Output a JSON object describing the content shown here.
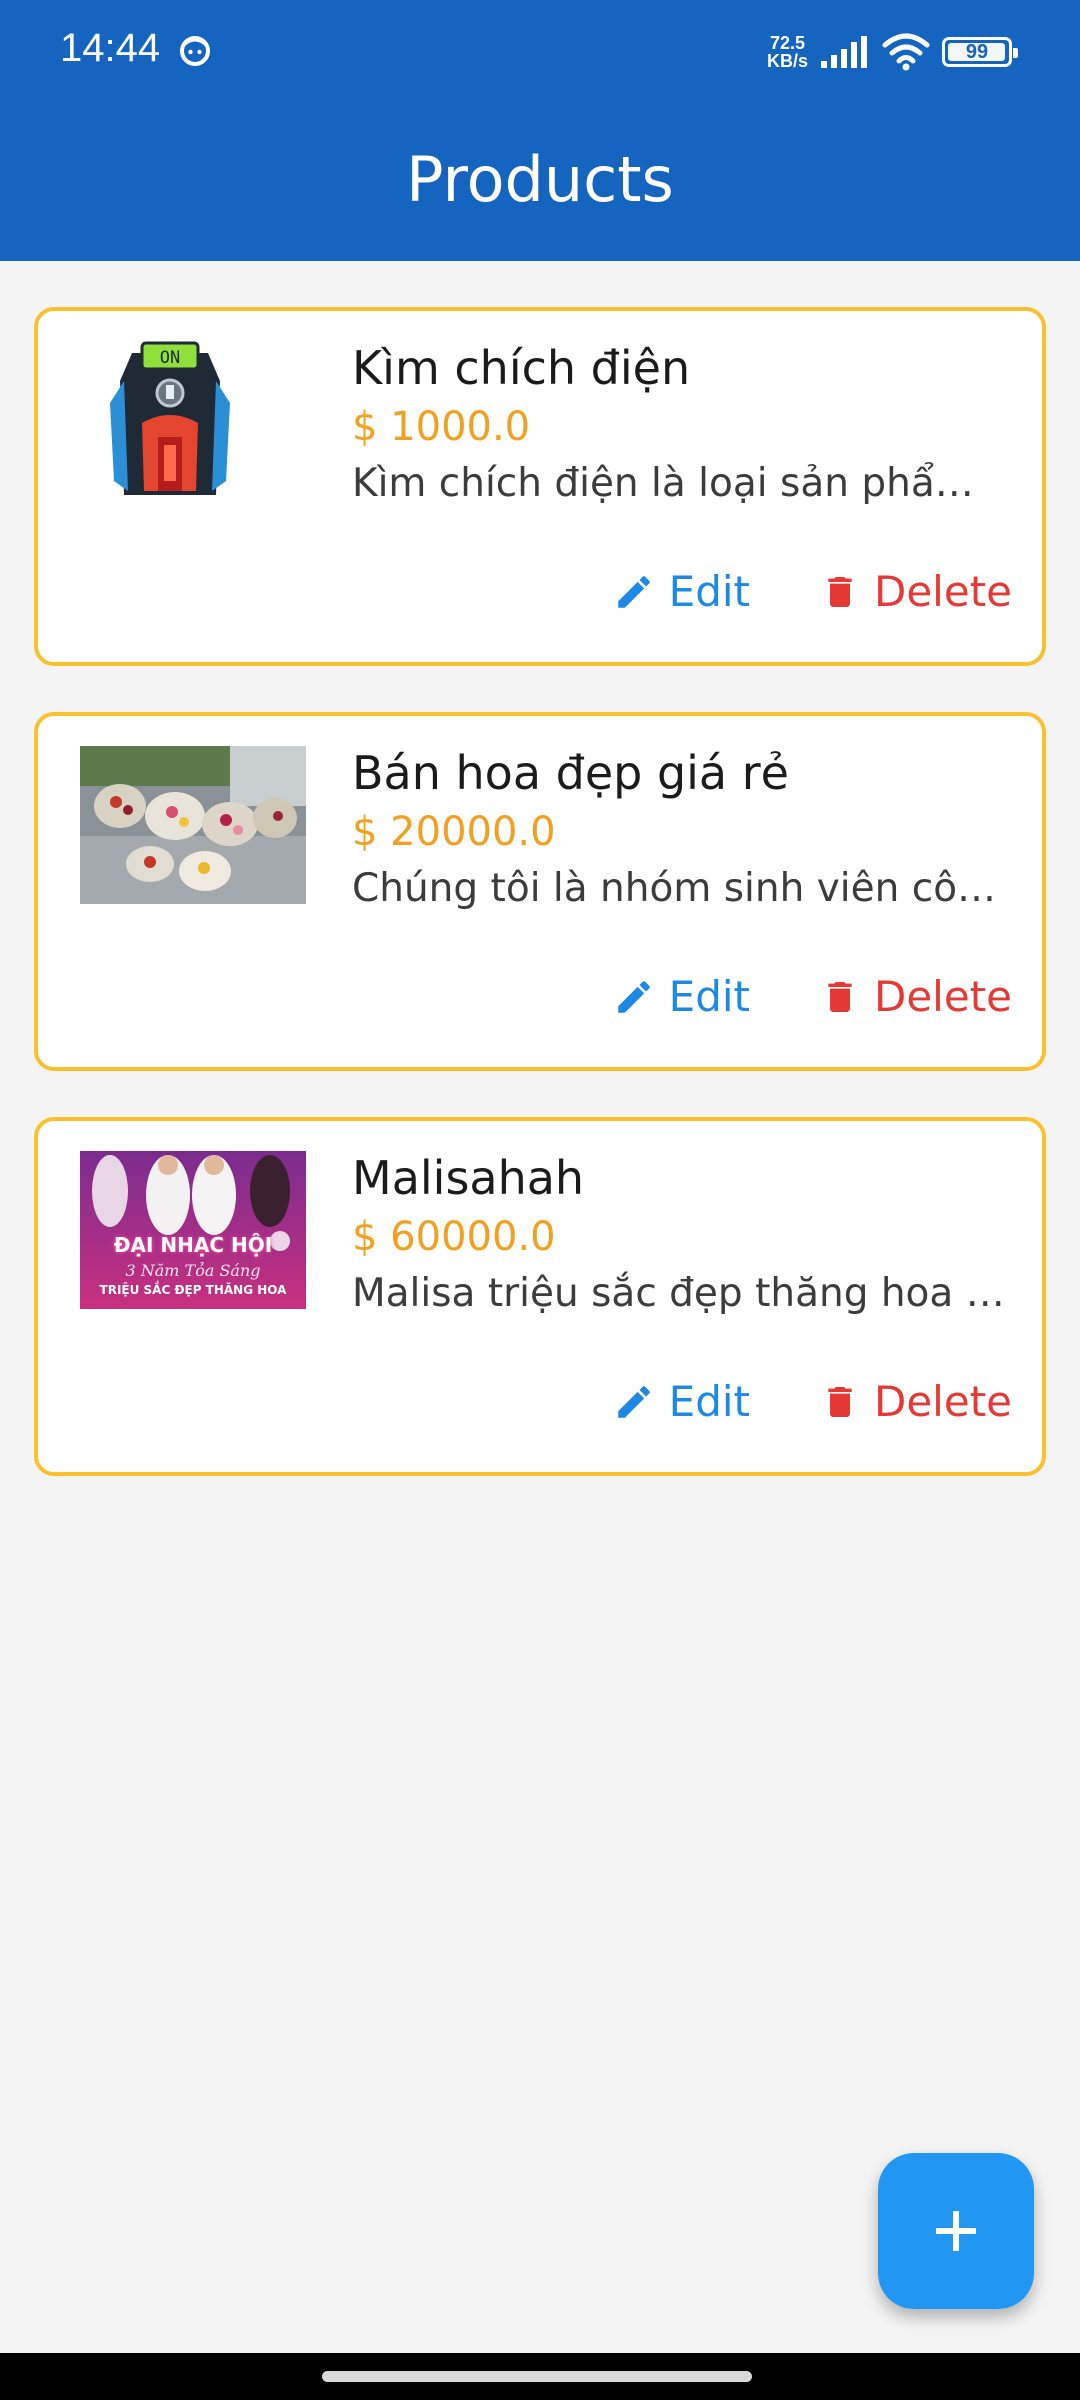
{
  "status_bar": {
    "time": "14:44",
    "net_speed_value": "72.5",
    "net_speed_unit": "KB/s",
    "battery": "99",
    "battery_level": 0.99
  },
  "app_bar": {
    "title": "Products"
  },
  "products": [
    {
      "name": "Kìm chích điện",
      "price": "$ 1000.0",
      "description": "Kìm chích điện là loại sản phẩ…",
      "image": "stun-device-photo",
      "edit_label": "Edit",
      "delete_label": "Delete"
    },
    {
      "name": "Bán hoa đẹp giá rẻ",
      "price": "$ 20000.0",
      "description": "Chúng tôi là nhóm sinh viên cô…",
      "image": "flower-bouquets-photo",
      "edit_label": "Edit",
      "delete_label": "Delete"
    },
    {
      "name": "Malisahah",
      "price": "$ 60000.0",
      "description": "Malisa triệu sắc đẹp thăng hoa …",
      "image": "music-event-poster",
      "poster_text": [
        "ĐẠI NHẠC HỘI",
        "3 Năm Tỏa Sáng",
        "TRIỆU SẮC ĐẸP THĂNG HOA"
      ],
      "edit_label": "Edit",
      "delete_label": "Delete"
    }
  ],
  "fab": {
    "icon": "plus-icon"
  },
  "colors": {
    "app_bar": "#1565c0",
    "card_border": "#f8c12d",
    "price": "#f2a01f",
    "edit": "#1e88e5",
    "delete": "#e53935",
    "fab": "#2196f3"
  }
}
